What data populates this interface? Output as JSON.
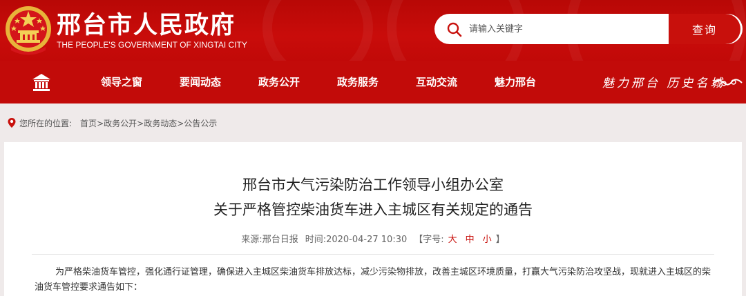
{
  "header": {
    "site_title": "邢台市人民政府",
    "site_subtitle": "THE PEOPLE'S GOVERNMENT OF XINGTAI CITY",
    "emblem_icon": "national-emblem-icon",
    "brand_color": "#c20b09"
  },
  "search": {
    "placeholder": "请输入关键字",
    "button_label": "查询",
    "icon": "search-icon"
  },
  "nav": {
    "home_icon": "home-building-icon",
    "items": [
      {
        "label": "领导之窗"
      },
      {
        "label": "要闻动态"
      },
      {
        "label": "政务公开"
      },
      {
        "label": "政务服务"
      },
      {
        "label": "互动交流"
      },
      {
        "label": "魅力邢台"
      }
    ],
    "slogan": "魅力邢台 历史名城"
  },
  "breadcrumb": {
    "label": "您所在的位置:",
    "items": [
      "首页",
      "政务公开",
      "政务动态",
      "公告公示"
    ],
    "separator": ">"
  },
  "article": {
    "title_line1": "邢台市大气污染防治工作领导小组办公室",
    "title_line2": "关于严格管控柴油货车进入主城区有关规定的通告",
    "source_label": "来源:",
    "source": "邢台日报",
    "time_label": "时间:",
    "time": "2020-04-27 10:30",
    "font_label": "【字号:",
    "font_sizes": [
      "大",
      "中",
      "小"
    ],
    "font_close": "】",
    "body": "为严格柴油货车管控，强化通行证管理，确保进入主城区柴油货车排放达标，减少污染物排放，改善主城区环境质量，打赢大气污染防治攻坚战，现就进入主城区的柴油货车管控要求通告如下："
  }
}
